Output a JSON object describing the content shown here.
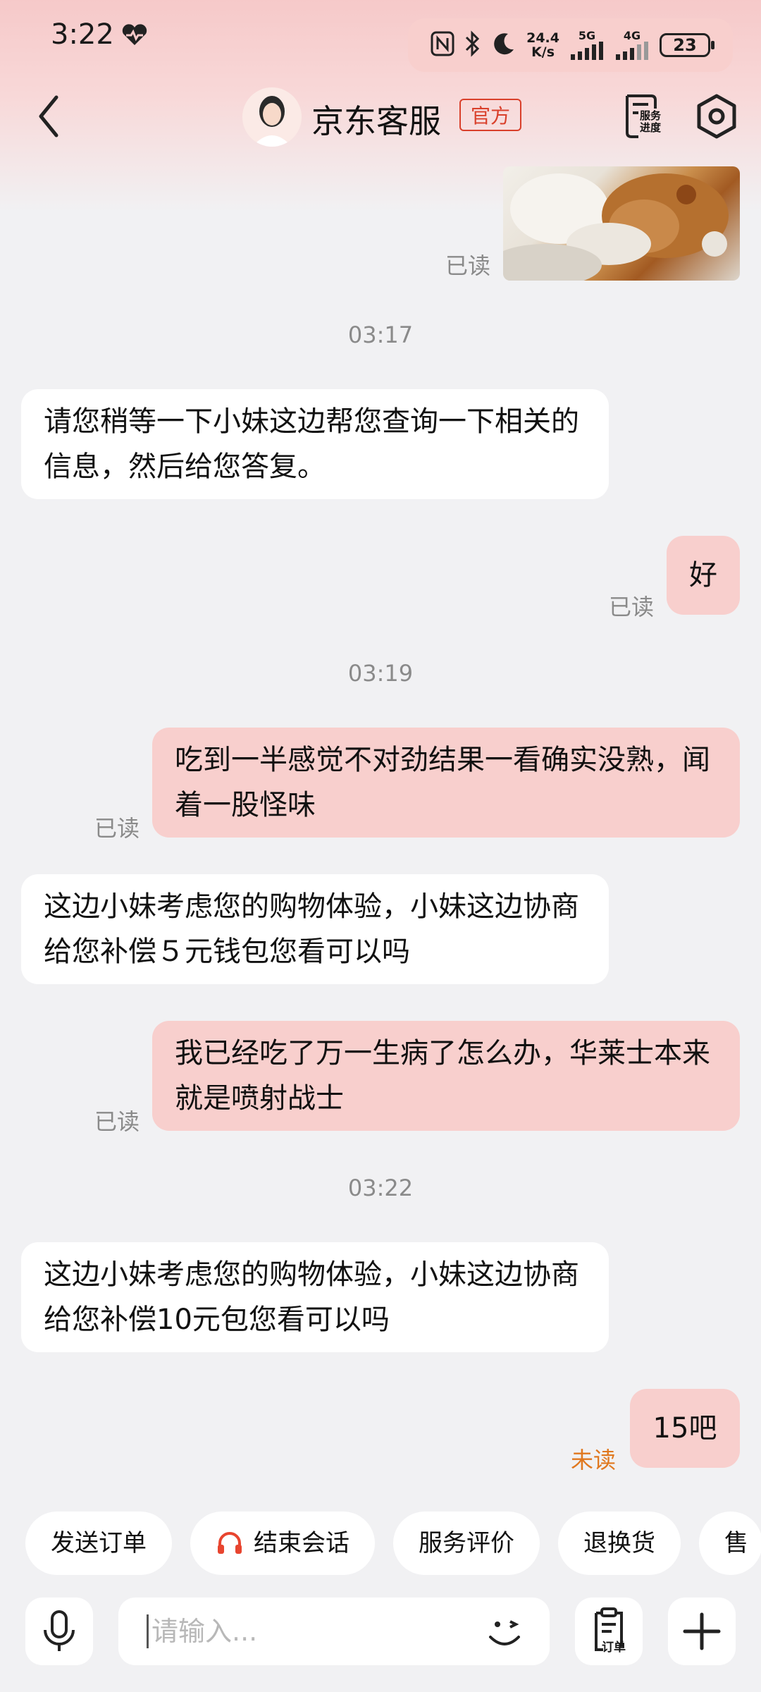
{
  "status_bar": {
    "time": "3:22",
    "net_speed_value": "24.4",
    "net_speed_unit": "K/s",
    "sim1": "5G",
    "sim2": "4G",
    "battery": "23"
  },
  "header": {
    "title": "京东客服",
    "badge": "官方",
    "service_progress": "服务\n进度"
  },
  "messages": [
    {
      "side": "right",
      "type": "image",
      "status": "已读"
    },
    {
      "type": "time",
      "text": "03:17"
    },
    {
      "side": "left",
      "text": "请您稍等一下小妹这边帮您查询一下相关的信息，然后给您答复。"
    },
    {
      "side": "right",
      "text": "好",
      "status": "已读"
    },
    {
      "type": "time",
      "text": "03:19"
    },
    {
      "side": "right",
      "text": "吃到一半感觉不对劲结果一看确实没熟，闻着一股怪味",
      "status": "已读"
    },
    {
      "side": "left",
      "text": "这边小妹考虑您的购物体验，小妹这边协商给您补偿５元钱包您看可以吗"
    },
    {
      "side": "right",
      "text": "我已经吃了万一生病了怎么办，华莱士本来就是喷射战士",
      "status": "已读"
    },
    {
      "type": "time",
      "text": "03:22"
    },
    {
      "side": "left",
      "text": "这边小妹考虑您的购物体验，小妹这边协商给您补偿10元包您看可以吗"
    },
    {
      "side": "right",
      "text": "15吧",
      "status": "未读"
    }
  ],
  "quick_actions": [
    "发送订单",
    "结束会话",
    "服务评价",
    "退换货",
    "售"
  ],
  "input": {
    "placeholder": "请输入...",
    "order_label": "订单"
  },
  "colors": {
    "right_bubble": "#f8cfcd",
    "left_bubble": "#ffffff",
    "background": "#f1f1f3",
    "badge": "#d9402b",
    "unread": "#e0781f"
  }
}
